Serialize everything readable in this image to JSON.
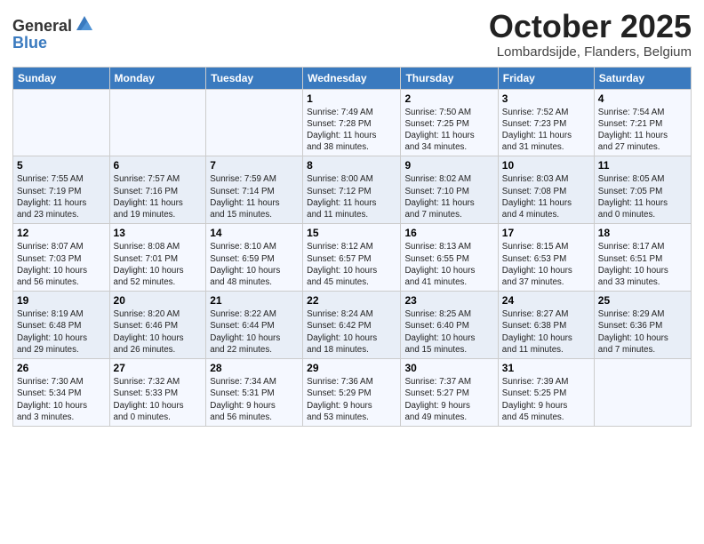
{
  "header": {
    "logo_general": "General",
    "logo_blue": "Blue",
    "month": "October 2025",
    "location": "Lombardsijde, Flanders, Belgium"
  },
  "days_of_week": [
    "Sunday",
    "Monday",
    "Tuesday",
    "Wednesday",
    "Thursday",
    "Friday",
    "Saturday"
  ],
  "weeks": [
    [
      {
        "day": "",
        "info": ""
      },
      {
        "day": "",
        "info": ""
      },
      {
        "day": "",
        "info": ""
      },
      {
        "day": "1",
        "info": "Sunrise: 7:49 AM\nSunset: 7:28 PM\nDaylight: 11 hours\nand 38 minutes."
      },
      {
        "day": "2",
        "info": "Sunrise: 7:50 AM\nSunset: 7:25 PM\nDaylight: 11 hours\nand 34 minutes."
      },
      {
        "day": "3",
        "info": "Sunrise: 7:52 AM\nSunset: 7:23 PM\nDaylight: 11 hours\nand 31 minutes."
      },
      {
        "day": "4",
        "info": "Sunrise: 7:54 AM\nSunset: 7:21 PM\nDaylight: 11 hours\nand 27 minutes."
      }
    ],
    [
      {
        "day": "5",
        "info": "Sunrise: 7:55 AM\nSunset: 7:19 PM\nDaylight: 11 hours\nand 23 minutes."
      },
      {
        "day": "6",
        "info": "Sunrise: 7:57 AM\nSunset: 7:16 PM\nDaylight: 11 hours\nand 19 minutes."
      },
      {
        "day": "7",
        "info": "Sunrise: 7:59 AM\nSunset: 7:14 PM\nDaylight: 11 hours\nand 15 minutes."
      },
      {
        "day": "8",
        "info": "Sunrise: 8:00 AM\nSunset: 7:12 PM\nDaylight: 11 hours\nand 11 minutes."
      },
      {
        "day": "9",
        "info": "Sunrise: 8:02 AM\nSunset: 7:10 PM\nDaylight: 11 hours\nand 7 minutes."
      },
      {
        "day": "10",
        "info": "Sunrise: 8:03 AM\nSunset: 7:08 PM\nDaylight: 11 hours\nand 4 minutes."
      },
      {
        "day": "11",
        "info": "Sunrise: 8:05 AM\nSunset: 7:05 PM\nDaylight: 11 hours\nand 0 minutes."
      }
    ],
    [
      {
        "day": "12",
        "info": "Sunrise: 8:07 AM\nSunset: 7:03 PM\nDaylight: 10 hours\nand 56 minutes."
      },
      {
        "day": "13",
        "info": "Sunrise: 8:08 AM\nSunset: 7:01 PM\nDaylight: 10 hours\nand 52 minutes."
      },
      {
        "day": "14",
        "info": "Sunrise: 8:10 AM\nSunset: 6:59 PM\nDaylight: 10 hours\nand 48 minutes."
      },
      {
        "day": "15",
        "info": "Sunrise: 8:12 AM\nSunset: 6:57 PM\nDaylight: 10 hours\nand 45 minutes."
      },
      {
        "day": "16",
        "info": "Sunrise: 8:13 AM\nSunset: 6:55 PM\nDaylight: 10 hours\nand 41 minutes."
      },
      {
        "day": "17",
        "info": "Sunrise: 8:15 AM\nSunset: 6:53 PM\nDaylight: 10 hours\nand 37 minutes."
      },
      {
        "day": "18",
        "info": "Sunrise: 8:17 AM\nSunset: 6:51 PM\nDaylight: 10 hours\nand 33 minutes."
      }
    ],
    [
      {
        "day": "19",
        "info": "Sunrise: 8:19 AM\nSunset: 6:48 PM\nDaylight: 10 hours\nand 29 minutes."
      },
      {
        "day": "20",
        "info": "Sunrise: 8:20 AM\nSunset: 6:46 PM\nDaylight: 10 hours\nand 26 minutes."
      },
      {
        "day": "21",
        "info": "Sunrise: 8:22 AM\nSunset: 6:44 PM\nDaylight: 10 hours\nand 22 minutes."
      },
      {
        "day": "22",
        "info": "Sunrise: 8:24 AM\nSunset: 6:42 PM\nDaylight: 10 hours\nand 18 minutes."
      },
      {
        "day": "23",
        "info": "Sunrise: 8:25 AM\nSunset: 6:40 PM\nDaylight: 10 hours\nand 15 minutes."
      },
      {
        "day": "24",
        "info": "Sunrise: 8:27 AM\nSunset: 6:38 PM\nDaylight: 10 hours\nand 11 minutes."
      },
      {
        "day": "25",
        "info": "Sunrise: 8:29 AM\nSunset: 6:36 PM\nDaylight: 10 hours\nand 7 minutes."
      }
    ],
    [
      {
        "day": "26",
        "info": "Sunrise: 7:30 AM\nSunset: 5:34 PM\nDaylight: 10 hours\nand 3 minutes."
      },
      {
        "day": "27",
        "info": "Sunrise: 7:32 AM\nSunset: 5:33 PM\nDaylight: 10 hours\nand 0 minutes."
      },
      {
        "day": "28",
        "info": "Sunrise: 7:34 AM\nSunset: 5:31 PM\nDaylight: 9 hours\nand 56 minutes."
      },
      {
        "day": "29",
        "info": "Sunrise: 7:36 AM\nSunset: 5:29 PM\nDaylight: 9 hours\nand 53 minutes."
      },
      {
        "day": "30",
        "info": "Sunrise: 7:37 AM\nSunset: 5:27 PM\nDaylight: 9 hours\nand 49 minutes."
      },
      {
        "day": "31",
        "info": "Sunrise: 7:39 AM\nSunset: 5:25 PM\nDaylight: 9 hours\nand 45 minutes."
      },
      {
        "day": "",
        "info": ""
      }
    ]
  ]
}
